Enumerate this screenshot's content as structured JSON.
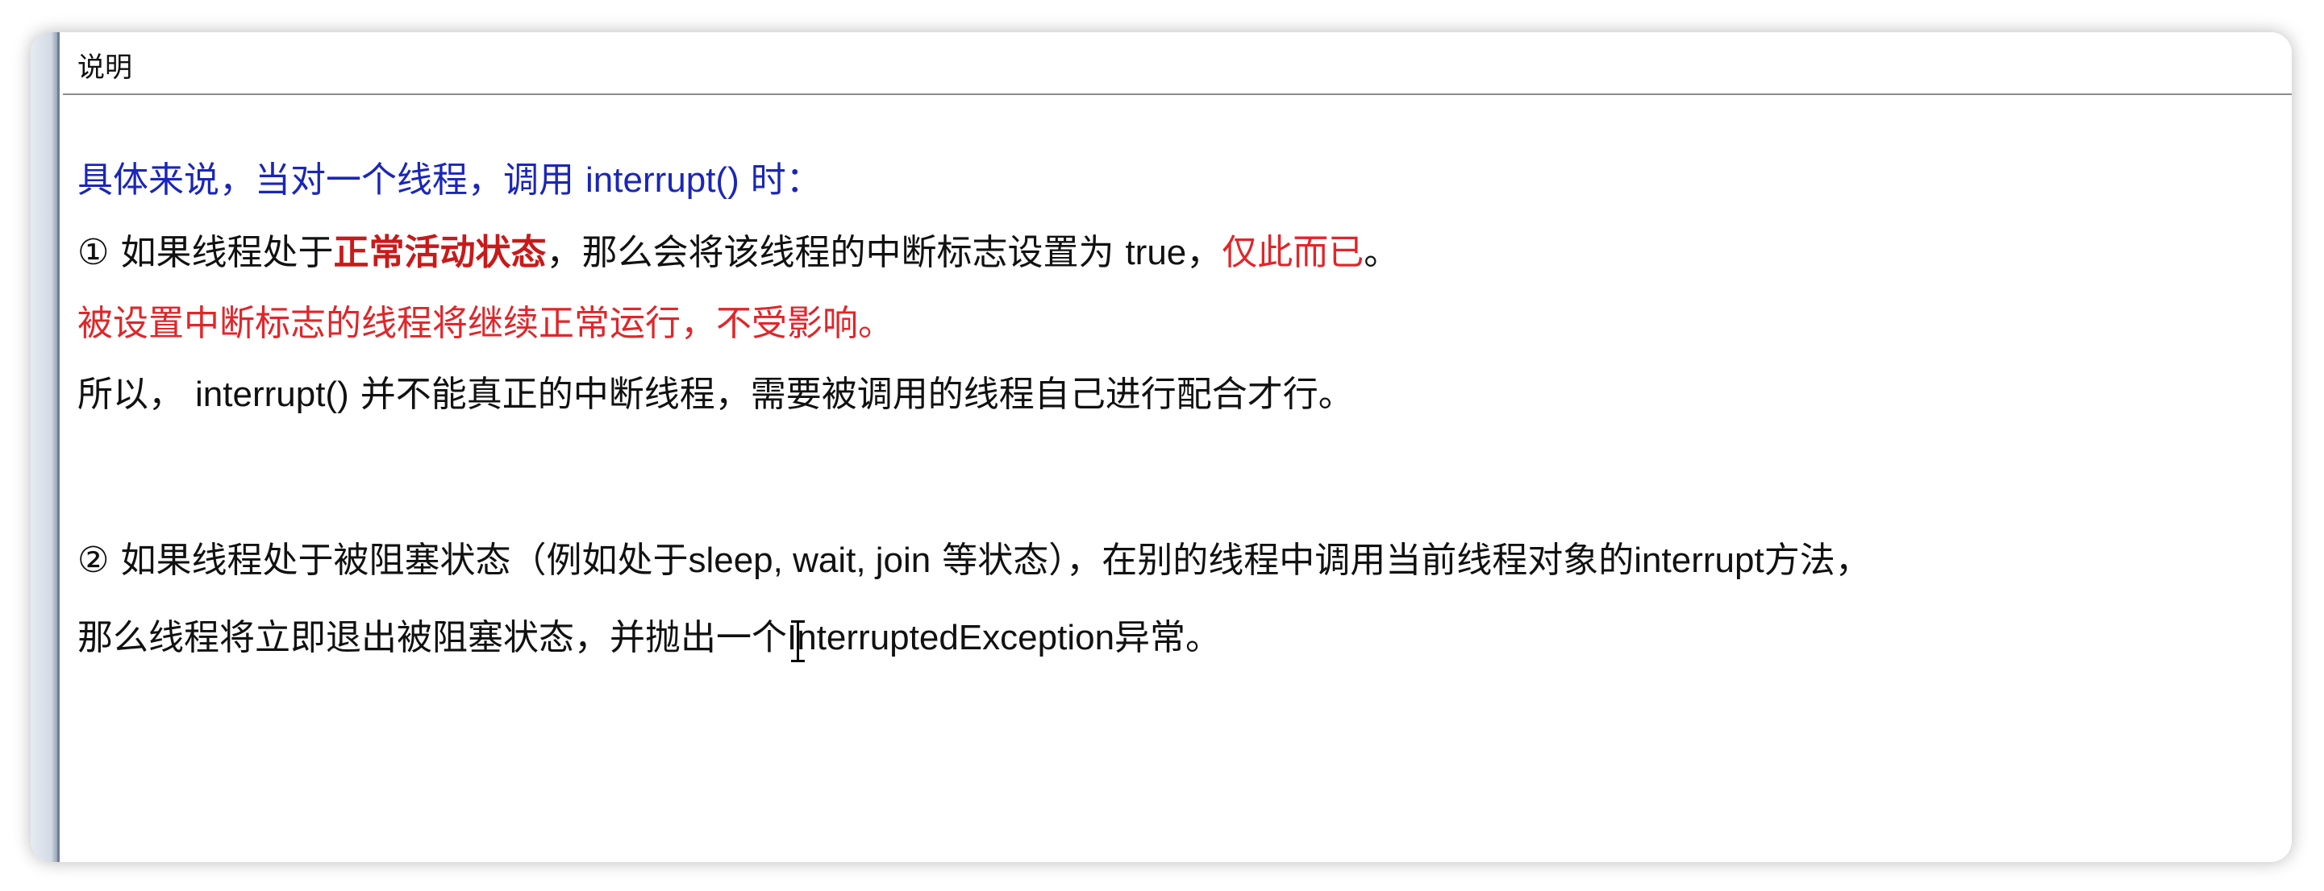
{
  "header": {
    "title": "说明"
  },
  "intro": {
    "part1": "具体来说，当对一个线程，调用",
    "code": "interrupt()",
    "part2": "时："
  },
  "point1": {
    "marker": "①",
    "part1": "如果线程处于",
    "emphasis": "正常活动状态",
    "part2": "，那么会将该线程的中断标志设置为",
    "code": "true",
    "part3": "，",
    "highlight": "仅此而已",
    "part4": "。"
  },
  "point1_note": "被设置中断标志的线程将继续正常运行，不受影响。",
  "point1_conclusion": {
    "part1": "所以，",
    "code": "interrupt()",
    "part2": "并不能真正的中断线程，需要被调用的线程自己进行配合才行。"
  },
  "point2": {
    "marker": "②",
    "part1": "如果线程处于被阻塞状态（例如处于",
    "code1": "sleep, wait, join",
    "part2": "等状态），在别的线程中调用当前线程对象的",
    "code2": "interrupt",
    "part3": "方法，"
  },
  "point2_continued": {
    "part1": "那么线程将立即退出被阻塞状态，并抛出一个",
    "code": "InterruptedException",
    "part2": "异常。"
  },
  "colors": {
    "blue_text": "#1a26b8",
    "red_text": "#e0262a",
    "bold_red_text": "#c81a1a"
  },
  "icons": {
    "cursor": "text-cursor-icon"
  }
}
